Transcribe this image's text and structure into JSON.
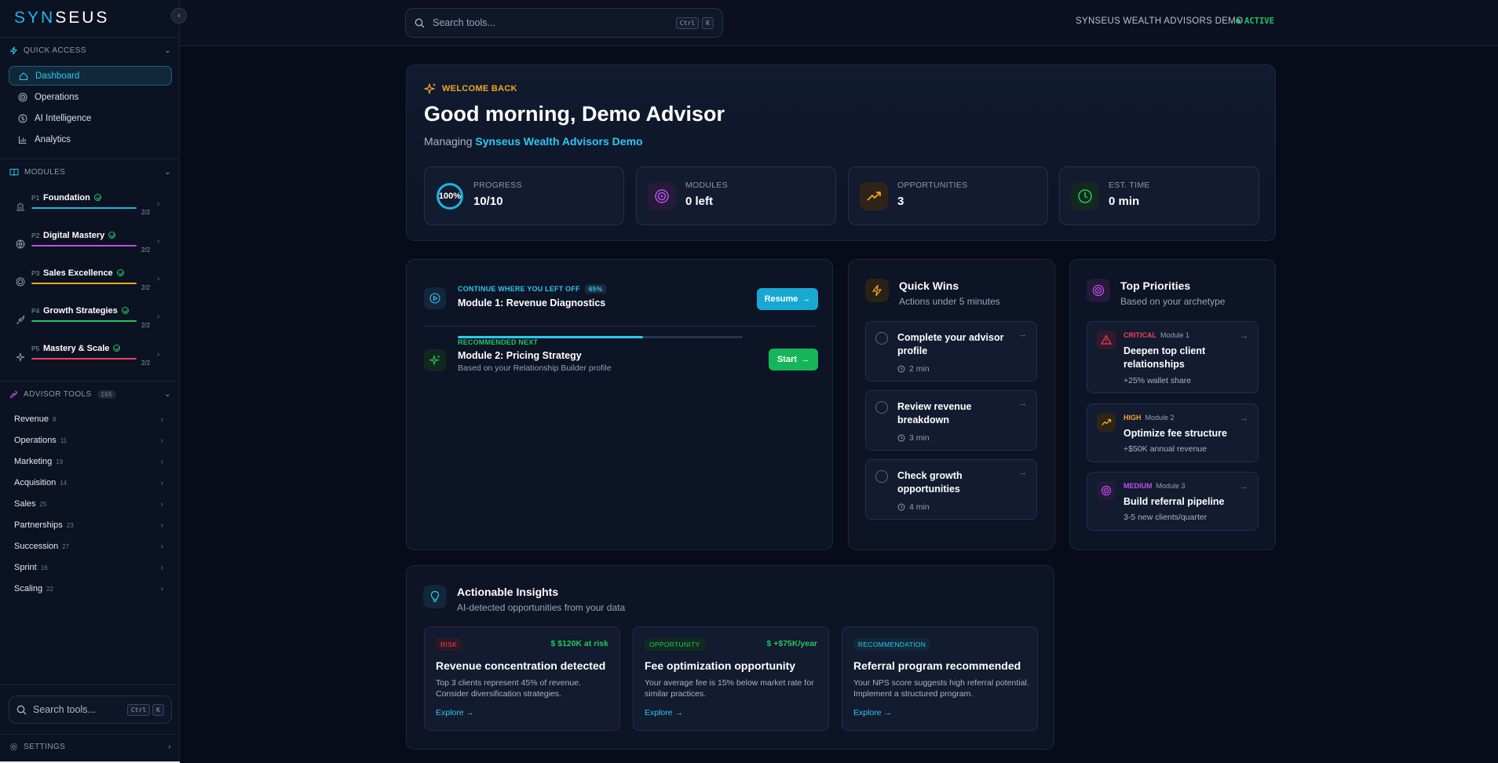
{
  "brand": {
    "logo_a": "SYN",
    "logo_b": "SEUS",
    "collapse": "‹"
  },
  "sidebar": {
    "quick_access": {
      "heading": "QUICK ACCESS",
      "items": [
        {
          "label": "Dashboard",
          "icon": "home-icon",
          "active": true
        },
        {
          "label": "Operations",
          "icon": "target-icon"
        },
        {
          "label": "AI Intelligence",
          "icon": "brain-icon"
        },
        {
          "label": "Analytics",
          "icon": "bar-chart-icon"
        }
      ]
    },
    "modules": {
      "heading": "MODULES",
      "items": [
        {
          "tag": "P1",
          "name": "Foundation",
          "fraction": "2/2",
          "color": "#19b6e4",
          "icon": "building-icon"
        },
        {
          "tag": "P2",
          "name": "Digital Mastery",
          "fraction": "2/2",
          "color": "#c04ee8",
          "icon": "globe-icon"
        },
        {
          "tag": "P3",
          "name": "Sales Excellence",
          "fraction": "2/2",
          "color": "#f5a524",
          "icon": "target-icon"
        },
        {
          "tag": "P4",
          "name": "Growth Strategies",
          "fraction": "2/2",
          "color": "#22c55e",
          "icon": "rocket-icon"
        },
        {
          "tag": "P5",
          "name": "Mastery & Scale",
          "fraction": "2/2",
          "color": "#f43f5e",
          "icon": "sparkle-icon"
        }
      ]
    },
    "advisor_tools": {
      "heading": "ADVISOR TOOLS",
      "count": "165",
      "items": [
        {
          "label": "Revenue",
          "count": "8"
        },
        {
          "label": "Operations",
          "count": "11"
        },
        {
          "label": "Marketing",
          "count": "19"
        },
        {
          "label": "Acquisition",
          "count": "14"
        },
        {
          "label": "Sales",
          "count": "25"
        },
        {
          "label": "Partnerships",
          "count": "23"
        },
        {
          "label": "Succession",
          "count": "27"
        },
        {
          "label": "Sprint",
          "count": "16"
        },
        {
          "label": "Scaling",
          "count": "22"
        }
      ]
    },
    "search": {
      "placeholder": "Search tools...",
      "kbd1": "Ctrl",
      "kbd2": "K"
    },
    "settings": "SETTINGS"
  },
  "topbar": {
    "search_placeholder": "Search tools...",
    "kbd1": "Ctrl",
    "kbd2": "K",
    "org": "SYNSEUS WEALTH ADVISORS DEMO",
    "status": "ACTIVE"
  },
  "welcome": {
    "tag": "WELCOME BACK",
    "greeting": "Good morning, Demo Advisor",
    "managing_prefix": "Managing",
    "org": "Synseus Wealth Advisors Demo",
    "stats": [
      {
        "label": "PROGRESS",
        "value": "10/10",
        "ring_text": "100%"
      },
      {
        "label": "MODULES",
        "value": "0 left"
      },
      {
        "label": "OPPORTUNITIES",
        "value": "3"
      },
      {
        "label": "EST. TIME",
        "value": "0 min"
      }
    ]
  },
  "continue": {
    "kicker": "CONTINUE WHERE YOU LEFT OFF",
    "percent": "65%",
    "progress_fraction": 0.65,
    "title": "Module 1: Revenue Diagnostics",
    "resume": "Resume",
    "rec_kicker": "RECOMMENDED NEXT",
    "rec_title": "Module 2: Pricing Strategy",
    "rec_sub": "Based on your Relationship Builder profile",
    "start": "Start"
  },
  "quick_wins": {
    "title": "Quick Wins",
    "subtitle": "Actions under 5 minutes",
    "items": [
      {
        "title": "Complete your advisor profile",
        "time": "2 min"
      },
      {
        "title": "Review revenue breakdown",
        "time": "3 min"
      },
      {
        "title": "Check growth opportunities",
        "time": "4 min"
      }
    ]
  },
  "priorities": {
    "title": "Top Priorities",
    "subtitle": "Based on your archetype",
    "items": [
      {
        "level": "CRITICAL",
        "module": "Module 1",
        "title": "Deepen top client relationships",
        "sub": "+25% wallet share",
        "color": "#f43f5e"
      },
      {
        "level": "HIGH",
        "module": "Module 2",
        "title": "Optimize fee structure",
        "sub": "+$50K annual revenue",
        "color": "#f5a524"
      },
      {
        "level": "MEDIUM",
        "module": "Module 3",
        "title": "Build referral pipeline",
        "sub": "3-5 new clients/quarter",
        "color": "#c04ee8"
      }
    ]
  },
  "insights": {
    "title": "Actionable Insights",
    "subtitle": "AI-detected opportunities from your data",
    "cards": [
      {
        "tag": "RISK",
        "amount": "$  $120K at risk",
        "title": "Revenue concentration detected",
        "desc": "Top 3 clients represent 45% of revenue. Consider diversification strategies.",
        "link": "Explore →"
      },
      {
        "tag": "OPPORTUNITY",
        "amount": "$  +$75K/year",
        "title": "Fee optimization opportunity",
        "desc": "Your average fee is 15% below market rate for similar practices.",
        "link": "Explore →"
      },
      {
        "tag": "RECOMMENDATION",
        "amount": "",
        "title": "Referral program recommended",
        "desc": "Your NPS score suggests high referral potential. Implement a structured program.",
        "link": "Explore →"
      }
    ]
  }
}
